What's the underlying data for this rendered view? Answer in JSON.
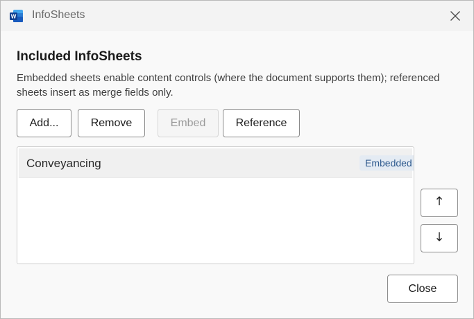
{
  "window": {
    "title": "InfoSheets",
    "app_icon": "word-icon",
    "close_icon": "close-icon"
  },
  "main": {
    "heading": "Included InfoSheets",
    "description": "Embedded sheets enable content controls (where the document supports them); referenced sheets insert as merge fields only."
  },
  "toolbar": {
    "add_label": "Add...",
    "remove_label": "Remove",
    "embed_label": "Embed",
    "reference_label": "Reference"
  },
  "sheets": [
    {
      "name": "Conveyancing",
      "status": "Embedded",
      "selected": true
    }
  ],
  "side_buttons": {
    "move_up_icon": "arrow-up-icon",
    "move_down_icon": "arrow-down-icon"
  },
  "footer": {
    "close_label": "Close"
  },
  "colors": {
    "accent": "#2e5a8e",
    "badge_bg": "#e4ebf3",
    "word_blue": "#185abd"
  }
}
